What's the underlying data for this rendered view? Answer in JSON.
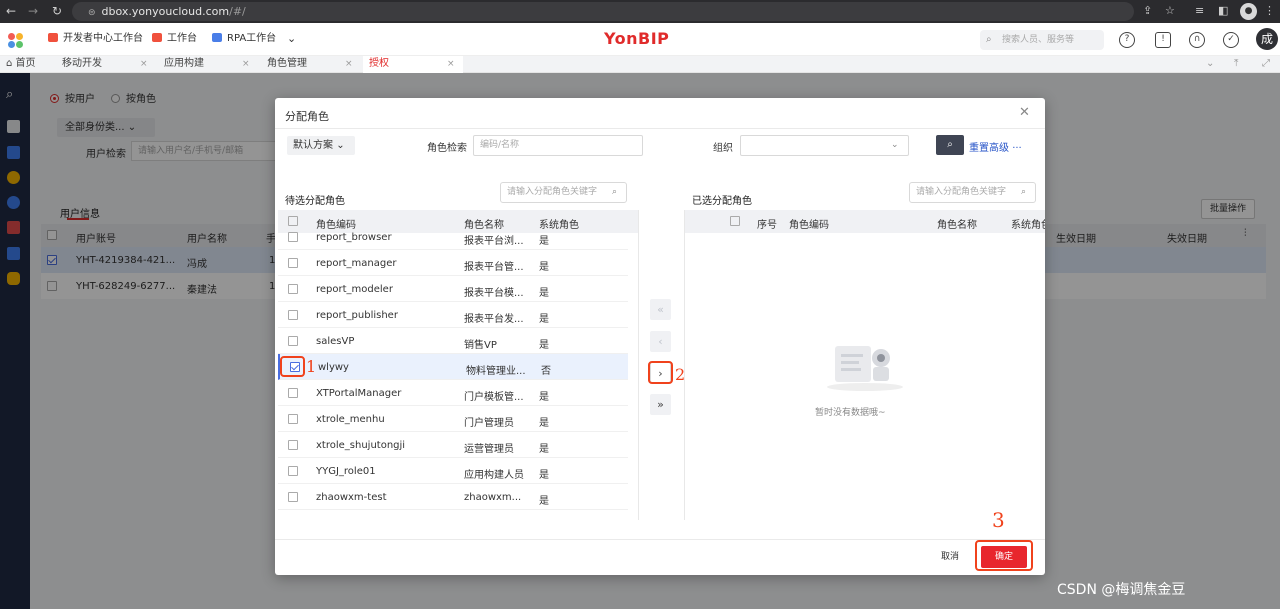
{
  "browser": {
    "url_host": "dbox.yonyoucloud.com",
    "url_path": "/#/"
  },
  "header": {
    "quick_tabs": [
      "开发者中心工作台",
      "工作台",
      "RPA工作台"
    ],
    "brand_yon": "Yon",
    "brand_bip": "BIP",
    "search_placeholder": "搜索人员、服务等",
    "user_initial": "成"
  },
  "page_tabs": [
    "首页",
    "移动开发",
    "应用构建",
    "角色管理",
    "授权"
  ],
  "background": {
    "radio_user": "按用户",
    "radio_role": "按角色",
    "identity_select": "全部身份类...",
    "user_search_label": "用户检索",
    "user_search_placeholder": "请输入用户名/手机号/邮箱",
    "tab_user_info": "用户信息",
    "batch_button": "批量操作",
    "columns": [
      "用户账号",
      "用户名称",
      "手",
      "生效日期",
      "失效日期"
    ],
    "rows": [
      {
        "account": "YHT-4219384-421...",
        "name": "冯成",
        "phone": "1"
      },
      {
        "account": "YHT-628249-6277...",
        "name": "秦建法",
        "phone": "1"
      }
    ]
  },
  "modal": {
    "title": "分配角色",
    "plan_button": "默认方案",
    "role_search_label": "角色检索",
    "role_search_placeholder": "编码/名称",
    "org_label": "组织",
    "reset_link": "重置",
    "advanced_link": "高级",
    "left_title": "待选分配角色",
    "left_search_placeholder": "请输入分配角色关键字",
    "left_columns": [
      "角色编码",
      "角色名称",
      "系统角色"
    ],
    "left_rows": [
      {
        "code": "report_browser",
        "name": "报表平台浏...",
        "sys": "是",
        "checked": false
      },
      {
        "code": "report_manager",
        "name": "报表平台管...",
        "sys": "是",
        "checked": false
      },
      {
        "code": "report_modeler",
        "name": "报表平台模...",
        "sys": "是",
        "checked": false
      },
      {
        "code": "report_publisher",
        "name": "报表平台发...",
        "sys": "是",
        "checked": false
      },
      {
        "code": "salesVP",
        "name": "销售VP",
        "sys": "是",
        "checked": false
      },
      {
        "code": "wlywy",
        "name": "物料管理业...",
        "sys": "否",
        "checked": true
      },
      {
        "code": "XTPortalManager",
        "name": "门户模板管...",
        "sys": "是",
        "checked": false
      },
      {
        "code": "xtrole_menhu",
        "name": "门户管理员",
        "sys": "是",
        "checked": false
      },
      {
        "code": "xtrole_shujutongji",
        "name": "运营管理员",
        "sys": "是",
        "checked": false
      },
      {
        "code": "YYGJ_role01",
        "name": "应用构建人员",
        "sys": "是",
        "checked": false
      },
      {
        "code": "zhaowxm-test",
        "name": "zhaowxm...",
        "sys": "是",
        "checked": false
      }
    ],
    "right_title": "已选分配角色",
    "right_search_placeholder": "请输入分配角色关键字",
    "right_columns": [
      "序号",
      "角色编码",
      "角色名称",
      "系统角色"
    ],
    "empty_text": "暂时没有数据哦~",
    "cancel_button": "取消",
    "confirm_button": "确定",
    "transfer_buttons": [
      "«",
      "‹",
      "›",
      "»"
    ]
  },
  "annotations": [
    "1",
    "2",
    "3"
  ],
  "watermark": "CSDN @梅调焦金豆"
}
